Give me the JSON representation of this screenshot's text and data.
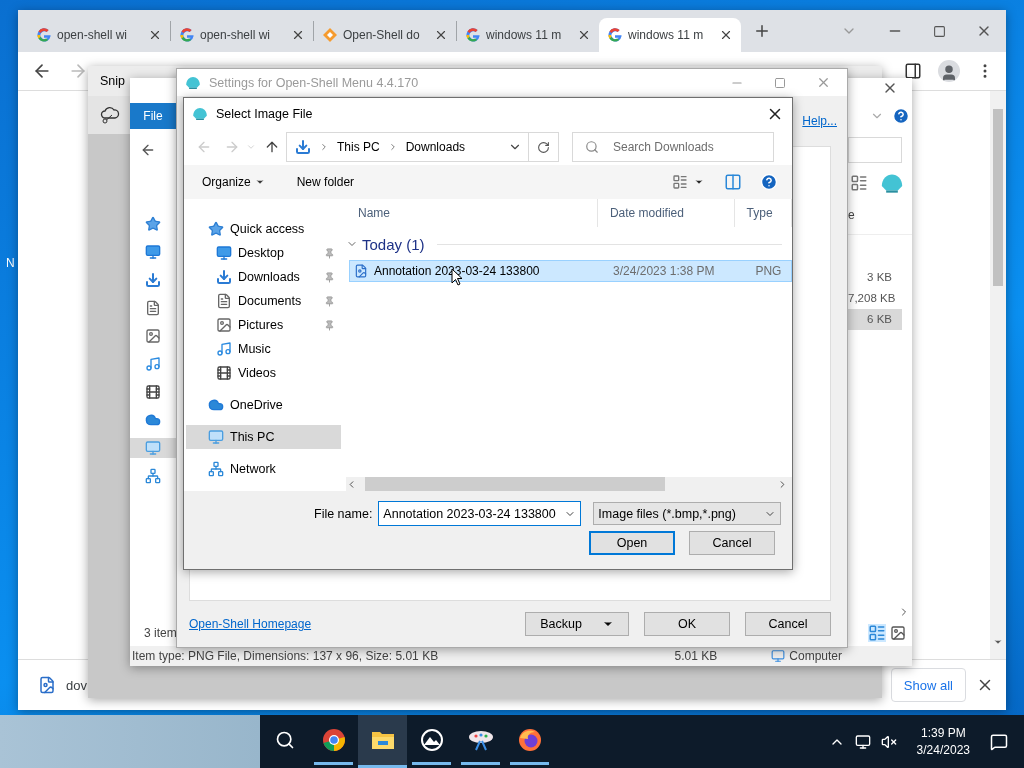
{
  "desktop": {
    "icon_labels": [
      "N"
    ]
  },
  "browser": {
    "tabs": [
      {
        "title": "open-shell wi",
        "kind": "google",
        "selected": false
      },
      {
        "title": "open-shell wi",
        "kind": "google",
        "selected": false
      },
      {
        "title": "Open-Shell do",
        "kind": "diamond",
        "selected": false
      },
      {
        "title": "windows 11 m",
        "kind": "google",
        "selected": false
      },
      {
        "title": "windows 11 m",
        "kind": "google",
        "selected": true
      }
    ],
    "download_bar": {
      "file": "dov",
      "show_all": "Show all"
    }
  },
  "snip_window": {
    "title": "Snip"
  },
  "explorer": {
    "ribbon_tab": "File",
    "column_fragment": "e",
    "sizes": [
      {
        "size": "3 KB",
        "selected": false
      },
      {
        "size": "7,208 KB",
        "selected": false
      },
      {
        "size": "6 KB",
        "selected": true
      }
    ],
    "item_count": "3 item",
    "status_details": "Item type: PNG File, Dimensions: 137 x 96, Size: 5.01 KB",
    "status_size": "5.01 KB",
    "status_location": "Computer"
  },
  "settings": {
    "title": "Settings for Open-Shell Menu 4.4.170",
    "help_link": "Help...",
    "homepage_link": "Open-Shell Homepage",
    "buttons": [
      {
        "label": "Backup",
        "kind": "split"
      },
      {
        "label": "OK",
        "kind": "plain"
      },
      {
        "label": "Cancel",
        "kind": "plain"
      }
    ]
  },
  "dialog": {
    "title": "Select Image File",
    "breadcrumb": [
      "This PC",
      "Downloads"
    ],
    "search": {
      "placeholder": "Search Downloads"
    },
    "commands": [
      {
        "label": "Organize",
        "kind": "menu"
      },
      {
        "label": "New folder",
        "kind": "plain"
      }
    ],
    "nav": [
      {
        "label": "Quick access",
        "kind": "star",
        "pinned": false,
        "selected": false,
        "children": [
          {
            "label": "Desktop",
            "kind": "desktop",
            "pinned": true,
            "selected": false
          },
          {
            "label": "Downloads",
            "kind": "download",
            "pinned": true,
            "selected": false
          },
          {
            "label": "Documents",
            "kind": "document",
            "pinned": true,
            "selected": false
          },
          {
            "label": "Pictures",
            "kind": "pictures",
            "pinned": true,
            "selected": false
          },
          {
            "label": "Music",
            "kind": "music",
            "pinned": false,
            "selected": false
          },
          {
            "label": "Videos",
            "kind": "video",
            "pinned": false,
            "selected": false
          }
        ]
      },
      {
        "label": "OneDrive",
        "kind": "cloud",
        "pinned": false,
        "selected": false
      },
      {
        "label": "This PC",
        "kind": "pc",
        "pinned": false,
        "selected": true
      },
      {
        "label": "Network",
        "kind": "network",
        "pinned": false,
        "selected": false
      }
    ],
    "columns": [
      "Name",
      "Date modified",
      "Type"
    ],
    "groups": [
      {
        "label": "Today (1)",
        "expanded": true,
        "files": [
          {
            "name": "Annotation 2023-03-24 133800",
            "date": "3/24/2023 1:38 PM",
            "type": "PNG",
            "selected": true
          }
        ]
      }
    ],
    "file_name": {
      "label": "File name:",
      "value": "Annotation 2023-03-24 133800"
    },
    "filter": "Image files (*.bmp,*.png)",
    "buttons": [
      {
        "label": "Open",
        "default": true
      },
      {
        "label": "Cancel",
        "default": false
      }
    ]
  },
  "taskbar": {
    "apps": [
      {
        "kind": "chrome",
        "active": false
      },
      {
        "kind": "explorer",
        "active": true
      },
      {
        "kind": "photos",
        "active": false
      },
      {
        "kind": "paint",
        "active": false
      },
      {
        "kind": "firefox",
        "active": false
      }
    ],
    "clock": {
      "time": "1:39 PM",
      "date": "3/24/2023"
    }
  }
}
